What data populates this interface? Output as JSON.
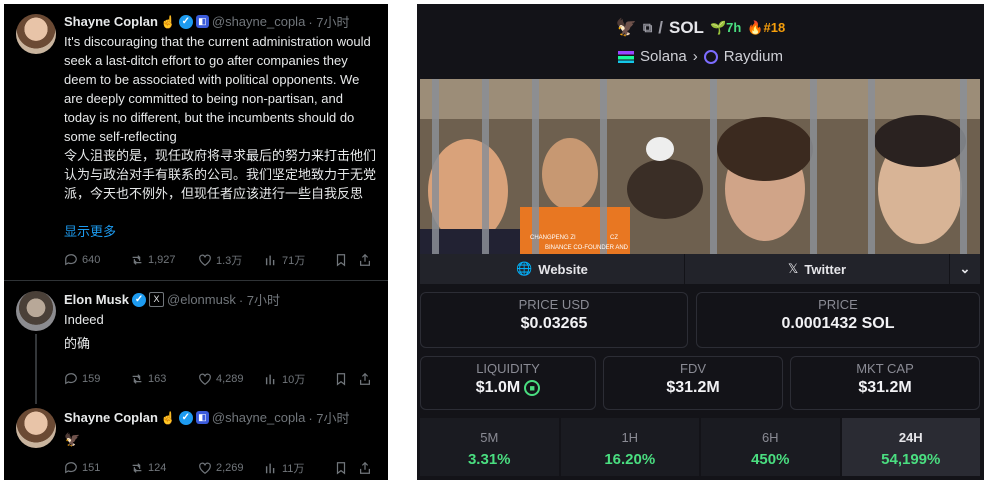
{
  "tweets": [
    {
      "name": "Shayne Coplan",
      "handle": "@shayne_copla",
      "time": "· 7小时",
      "text_en": "It's discouraging that the current administration would seek a last-ditch effort to go after companies they deem to be associated with political opponents. We are deeply committed to being non-partisan, and today is no different, but the incumbents should do some self-reflecting",
      "text_zh": "令人沮丧的是，现任政府将寻求最后的努力来打击他们认为与政治对手有联系的公司。我们坚定地致力于无党派，今天也不例外，但现任者应该进行一些自我反思",
      "more": "显示更多",
      "replies": "640",
      "reposts": "1,927",
      "likes": "1.3万",
      "views": "71万"
    },
    {
      "name": "Elon Musk",
      "handle": "@elonmusk",
      "time": "· 7小时",
      "text_en": "Indeed",
      "text_zh": "的确",
      "replies": "159",
      "reposts": "163",
      "likes": "4,289",
      "views": "10万"
    },
    {
      "name": "Shayne Coplan",
      "handle": "@shayne_copla",
      "time": "· 7小时",
      "text_emoji": "🦅",
      "replies": "151",
      "reposts": "124",
      "likes": "2,269",
      "views": "11万"
    }
  ],
  "token": {
    "symbol": "SOL",
    "age": "7h",
    "rank": "#18",
    "chain": "Solana",
    "dex": "Raydium",
    "links": {
      "website": "Website",
      "twitter": "Twitter"
    },
    "stats": {
      "price_usd_label": "PRICE USD",
      "price_usd": "$0.03265",
      "price_label": "PRICE",
      "price": "0.0001432 SOL",
      "liquidity_label": "LIQUIDITY",
      "liquidity": "$1.0M",
      "fdv_label": "FDV",
      "fdv": "$31.2M",
      "mktcap_label": "MKT CAP",
      "mktcap": "$31.2M"
    },
    "performance": [
      {
        "label": "5M",
        "value": "3.31%"
      },
      {
        "label": "1H",
        "value": "16.20%"
      },
      {
        "label": "6H",
        "value": "450%"
      },
      {
        "label": "24H",
        "value": "54,199%"
      }
    ],
    "banner_text": [
      "CHANGPENG ZI",
      "CZ",
      "BINANCE CO-FOUNDER AND"
    ]
  },
  "colors": {
    "accent": "#1d9bf0",
    "positive": "#4ade80",
    "rank": "#f59e0b"
  }
}
